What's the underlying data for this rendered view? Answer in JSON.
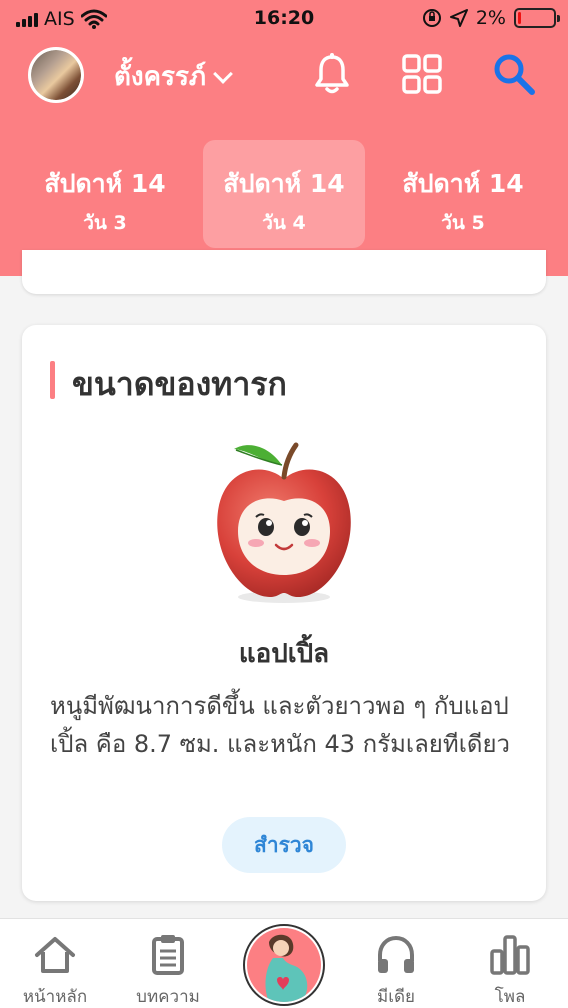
{
  "status_bar": {
    "carrier": "AIS",
    "time": "16:20",
    "battery_percent": "2%",
    "battery_level": 0.02,
    "icons": [
      "signal-icon",
      "wifi-icon",
      "rotation-lock-icon",
      "location-arrow-icon",
      "battery-icon"
    ]
  },
  "header": {
    "profile_name": "ตั้งครรภ์",
    "icons": [
      "bell-icon",
      "grid-icon",
      "search-icon"
    ],
    "background_color": "#fc7f83"
  },
  "day_tabs": [
    {
      "week": "สัปดาห์ 14",
      "day": "วัน 3",
      "active": false
    },
    {
      "week": "สัปดาห์ 14",
      "day": "วัน 4",
      "active": true
    },
    {
      "week": "สัปดาห์ 14",
      "day": "วัน 5",
      "active": false
    }
  ],
  "baby_size_card": {
    "title": "ขนาดของทารก",
    "fruit_icon": "apple-icon",
    "fruit_name": "แอปเปิ้ล",
    "description": "หนูมีพัฒนาการดีขึ้น และตัวยาวพอ ๆ กับแอปเปิ้ล คือ 8.7 ซม. และหนัก 43 กรัมเลยทีเดียว",
    "button_label": "สำรวจ"
  },
  "bottom_nav": {
    "items": [
      {
        "label": "หน้าหลัก",
        "icon": "home-icon"
      },
      {
        "label": "บทความ",
        "icon": "clipboard-icon"
      },
      {
        "label": "มีเดีย",
        "icon": "headphones-icon"
      },
      {
        "label": "โพล",
        "icon": "bar-chart-icon"
      }
    ],
    "center_icon": "pregnant-woman-icon"
  }
}
